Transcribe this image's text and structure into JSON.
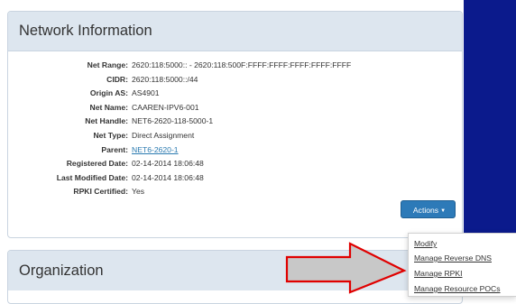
{
  "network_panel": {
    "title": "Network Information",
    "rows": [
      {
        "label": "Net Range:",
        "value": "2620:118:5000:: - 2620:118:500F:FFFF:FFFF:FFFF:FFFF:FFFF"
      },
      {
        "label": "CIDR:",
        "value": "2620:118:5000::/44"
      },
      {
        "label": "Origin AS:",
        "value": "AS4901"
      },
      {
        "label": "Net Name:",
        "value": "CAAREN-IPV6-001"
      },
      {
        "label": "Net Handle:",
        "value": "NET6-2620-118-5000-1"
      },
      {
        "label": "Net Type:",
        "value": "Direct Assignment"
      },
      {
        "label": "Parent:",
        "value": "NET6-2620-1"
      },
      {
        "label": "Registered Date:",
        "value": "02-14-2014 18:06:48"
      },
      {
        "label": "Last Modified Date:",
        "value": "02-14-2014 18:06:48"
      },
      {
        "label": "RPKI Certified:",
        "value": "Yes"
      }
    ],
    "actions_label": "Actions"
  },
  "actions_menu": {
    "items": [
      "Modify",
      "Manage Reverse DNS",
      "Manage RPKI",
      "Manage Resource POCs"
    ]
  },
  "org_panel": {
    "title": "Organization"
  },
  "colors": {
    "heading_bg": "#dde6ef",
    "button": "#2d7ab8",
    "link": "#2a7ab0",
    "arrow_fill": "#c8c8c8",
    "arrow_stroke": "#e00000",
    "right_band": "#0b1a8c"
  }
}
